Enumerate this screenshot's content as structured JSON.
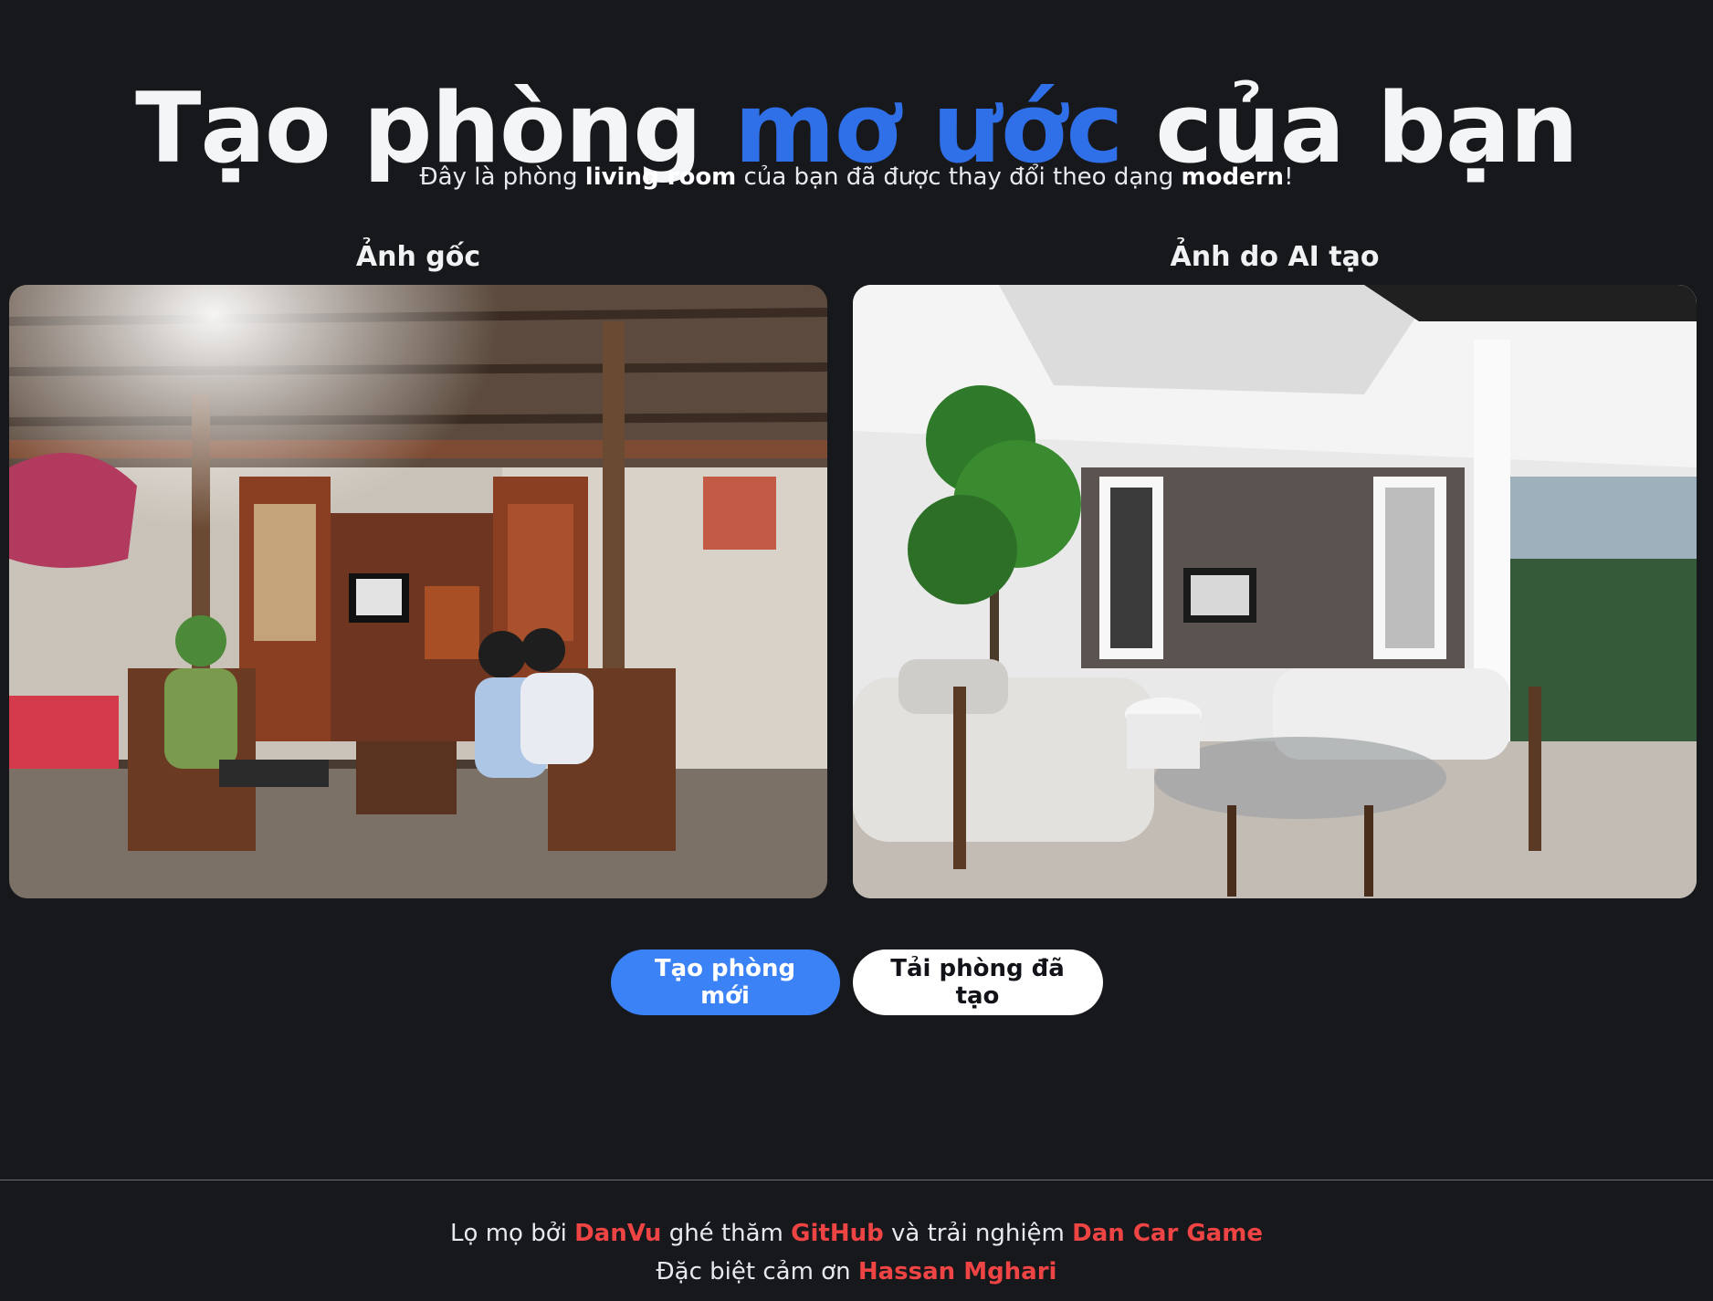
{
  "header": {
    "title_part1": "Tạo phòng ",
    "title_accent": "mơ ước",
    "title_part2": " của bạn",
    "subtitle_prefix": "Đây là phòng ",
    "room_type": "living room",
    "subtitle_middle": " của bạn đã được thay đổi theo dạng ",
    "style": "modern",
    "subtitle_suffix": "!"
  },
  "panels": {
    "original_label": "Ảnh gốc",
    "generated_label": "Ảnh do AI tạo"
  },
  "actions": {
    "new_room_label": "Tạo phòng mới",
    "download_label": "Tải phòng đã tạo"
  },
  "footer": {
    "line1_prefix": "Lọ mọ bởi ",
    "author": "DanVu",
    "line1_middle": " ghé thăm ",
    "github": "GitHub",
    "line1_middle2": " và trải nghiệm ",
    "game": "Dan Car Game",
    "line2_prefix": "Đặc biệt cảm ơn ",
    "thanks": "Hassan Mghari"
  },
  "colors": {
    "background": "#17181c",
    "accent": "#2f6fe8",
    "primary_button": "#3b82f6",
    "link": "#ef4444"
  }
}
